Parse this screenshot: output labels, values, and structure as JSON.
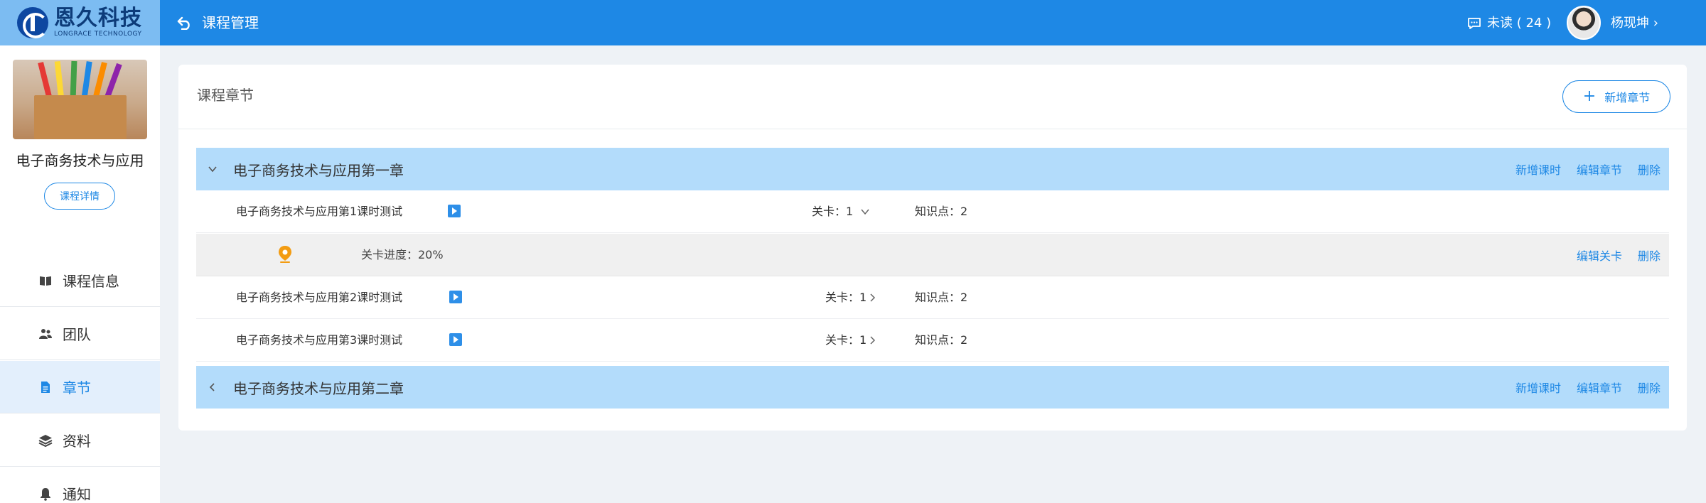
{
  "header": {
    "logo_cn": "恩久科技",
    "logo_en": "LONGRACE TECHNOLOGY",
    "title": "课程管理",
    "unread": "未读 ( 24 )",
    "username": "杨现坤 ›",
    "bg_color": "#1e88e5"
  },
  "sidebar": {
    "course_name": "电子商务技术与应用",
    "detail_button": "课程详情",
    "items": [
      {
        "label": "课程信息",
        "icon": "book-icon"
      },
      {
        "label": "团队",
        "icon": "team-icon"
      },
      {
        "label": "章节",
        "icon": "document-icon",
        "active": true
      },
      {
        "label": "资料",
        "icon": "layers-icon"
      },
      {
        "label": "通知",
        "icon": "bell-icon"
      }
    ]
  },
  "main": {
    "title": "课程章节",
    "add_chapter": "新增章节",
    "add_chapter_plus": "+",
    "chapters": [
      {
        "title": "电子商务技术与应用第一章",
        "expanded": true,
        "actions": [
          "新增课时",
          "编辑章节",
          "删除"
        ],
        "lessons": [
          {
            "name": "电子商务技术与应用第1课时测试",
            "level": "关卡：1",
            "knowledge": "知识点：2",
            "level_expanded": true
          },
          {
            "name": "电子商务技术与应用第2课时测试",
            "level": "关卡：1",
            "knowledge": "知识点：2",
            "level_expanded": false
          },
          {
            "name": "电子商务技术与应用第3课时测试",
            "level": "关卡：1",
            "knowledge": "知识点：2",
            "level_expanded": false
          }
        ],
        "progress": {
          "text": "关卡进度：20%",
          "actions": [
            "编辑关卡",
            "删除"
          ]
        }
      },
      {
        "title": "电子商务技术与应用第二章",
        "expanded": false,
        "actions": [
          "新增课时",
          "编辑章节",
          "删除"
        ]
      }
    ]
  }
}
